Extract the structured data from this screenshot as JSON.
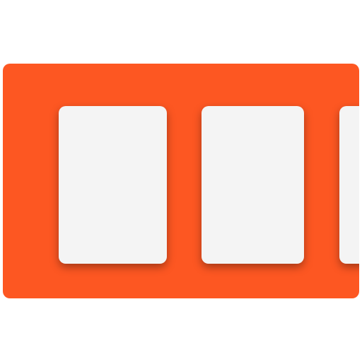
{
  "colors": {
    "panel": "#fd5722",
    "card": "#f4f4f4",
    "background": "#ffffff"
  },
  "carousel": {
    "cards": [
      {
        "id": "card-1",
        "visibility": "full"
      },
      {
        "id": "card-2",
        "visibility": "full"
      },
      {
        "id": "card-3",
        "visibility": "partial"
      }
    ]
  }
}
